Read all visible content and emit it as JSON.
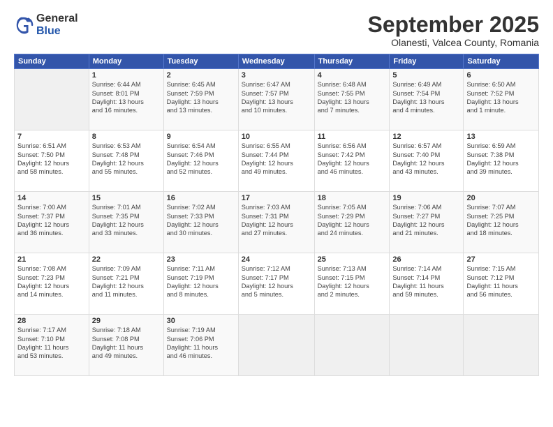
{
  "header": {
    "logo_line1": "General",
    "logo_line2": "Blue",
    "month": "September 2025",
    "location": "Olanesti, Valcea County, Romania"
  },
  "weekdays": [
    "Sunday",
    "Monday",
    "Tuesday",
    "Wednesday",
    "Thursday",
    "Friday",
    "Saturday"
  ],
  "weeks": [
    [
      {
        "day": "",
        "info": ""
      },
      {
        "day": "1",
        "info": "Sunrise: 6:44 AM\nSunset: 8:01 PM\nDaylight: 13 hours\nand 16 minutes."
      },
      {
        "day": "2",
        "info": "Sunrise: 6:45 AM\nSunset: 7:59 PM\nDaylight: 13 hours\nand 13 minutes."
      },
      {
        "day": "3",
        "info": "Sunrise: 6:47 AM\nSunset: 7:57 PM\nDaylight: 13 hours\nand 10 minutes."
      },
      {
        "day": "4",
        "info": "Sunrise: 6:48 AM\nSunset: 7:55 PM\nDaylight: 13 hours\nand 7 minutes."
      },
      {
        "day": "5",
        "info": "Sunrise: 6:49 AM\nSunset: 7:54 PM\nDaylight: 13 hours\nand 4 minutes."
      },
      {
        "day": "6",
        "info": "Sunrise: 6:50 AM\nSunset: 7:52 PM\nDaylight: 13 hours\nand 1 minute."
      }
    ],
    [
      {
        "day": "7",
        "info": "Sunrise: 6:51 AM\nSunset: 7:50 PM\nDaylight: 12 hours\nand 58 minutes."
      },
      {
        "day": "8",
        "info": "Sunrise: 6:53 AM\nSunset: 7:48 PM\nDaylight: 12 hours\nand 55 minutes."
      },
      {
        "day": "9",
        "info": "Sunrise: 6:54 AM\nSunset: 7:46 PM\nDaylight: 12 hours\nand 52 minutes."
      },
      {
        "day": "10",
        "info": "Sunrise: 6:55 AM\nSunset: 7:44 PM\nDaylight: 12 hours\nand 49 minutes."
      },
      {
        "day": "11",
        "info": "Sunrise: 6:56 AM\nSunset: 7:42 PM\nDaylight: 12 hours\nand 46 minutes."
      },
      {
        "day": "12",
        "info": "Sunrise: 6:57 AM\nSunset: 7:40 PM\nDaylight: 12 hours\nand 43 minutes."
      },
      {
        "day": "13",
        "info": "Sunrise: 6:59 AM\nSunset: 7:38 PM\nDaylight: 12 hours\nand 39 minutes."
      }
    ],
    [
      {
        "day": "14",
        "info": "Sunrise: 7:00 AM\nSunset: 7:37 PM\nDaylight: 12 hours\nand 36 minutes."
      },
      {
        "day": "15",
        "info": "Sunrise: 7:01 AM\nSunset: 7:35 PM\nDaylight: 12 hours\nand 33 minutes."
      },
      {
        "day": "16",
        "info": "Sunrise: 7:02 AM\nSunset: 7:33 PM\nDaylight: 12 hours\nand 30 minutes."
      },
      {
        "day": "17",
        "info": "Sunrise: 7:03 AM\nSunset: 7:31 PM\nDaylight: 12 hours\nand 27 minutes."
      },
      {
        "day": "18",
        "info": "Sunrise: 7:05 AM\nSunset: 7:29 PM\nDaylight: 12 hours\nand 24 minutes."
      },
      {
        "day": "19",
        "info": "Sunrise: 7:06 AM\nSunset: 7:27 PM\nDaylight: 12 hours\nand 21 minutes."
      },
      {
        "day": "20",
        "info": "Sunrise: 7:07 AM\nSunset: 7:25 PM\nDaylight: 12 hours\nand 18 minutes."
      }
    ],
    [
      {
        "day": "21",
        "info": "Sunrise: 7:08 AM\nSunset: 7:23 PM\nDaylight: 12 hours\nand 14 minutes."
      },
      {
        "day": "22",
        "info": "Sunrise: 7:09 AM\nSunset: 7:21 PM\nDaylight: 12 hours\nand 11 minutes."
      },
      {
        "day": "23",
        "info": "Sunrise: 7:11 AM\nSunset: 7:19 PM\nDaylight: 12 hours\nand 8 minutes."
      },
      {
        "day": "24",
        "info": "Sunrise: 7:12 AM\nSunset: 7:17 PM\nDaylight: 12 hours\nand 5 minutes."
      },
      {
        "day": "25",
        "info": "Sunrise: 7:13 AM\nSunset: 7:15 PM\nDaylight: 12 hours\nand 2 minutes."
      },
      {
        "day": "26",
        "info": "Sunrise: 7:14 AM\nSunset: 7:14 PM\nDaylight: 11 hours\nand 59 minutes."
      },
      {
        "day": "27",
        "info": "Sunrise: 7:15 AM\nSunset: 7:12 PM\nDaylight: 11 hours\nand 56 minutes."
      }
    ],
    [
      {
        "day": "28",
        "info": "Sunrise: 7:17 AM\nSunset: 7:10 PM\nDaylight: 11 hours\nand 53 minutes."
      },
      {
        "day": "29",
        "info": "Sunrise: 7:18 AM\nSunset: 7:08 PM\nDaylight: 11 hours\nand 49 minutes."
      },
      {
        "day": "30",
        "info": "Sunrise: 7:19 AM\nSunset: 7:06 PM\nDaylight: 11 hours\nand 46 minutes."
      },
      {
        "day": "",
        "info": ""
      },
      {
        "day": "",
        "info": ""
      },
      {
        "day": "",
        "info": ""
      },
      {
        "day": "",
        "info": ""
      }
    ]
  ]
}
